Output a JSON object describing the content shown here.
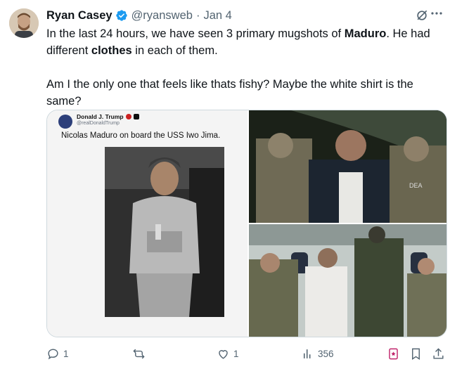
{
  "author": {
    "name": "Ryan Casey",
    "handle": "@ryansweb",
    "separator": "·",
    "date": "Jan 4"
  },
  "tweet": {
    "line1_a": "In the last 24 hours, we have seen 3 primary mugshots of ",
    "line1_b": "Maduro",
    "line1_c": ". He had different ",
    "line1_d": "clothes",
    "line1_e": " in each of them.",
    "line2": "Am I the only one that feels like thats fishy? Maybe the white shirt is the same?"
  },
  "embedded_post": {
    "name": "Donald J. Trump",
    "handle": "@realDonaldTrump",
    "text": "Nicolas Maduro on board the USS Iwo Jima."
  },
  "photo_labels": {
    "vest_patch": "DEA"
  },
  "actions": {
    "replies": "1",
    "reposts": "",
    "likes": "1",
    "views": "356"
  },
  "colors": {
    "verified": "#1d9bf0",
    "muted_text": "#536471",
    "bookmark_accent": "#c0246b"
  }
}
